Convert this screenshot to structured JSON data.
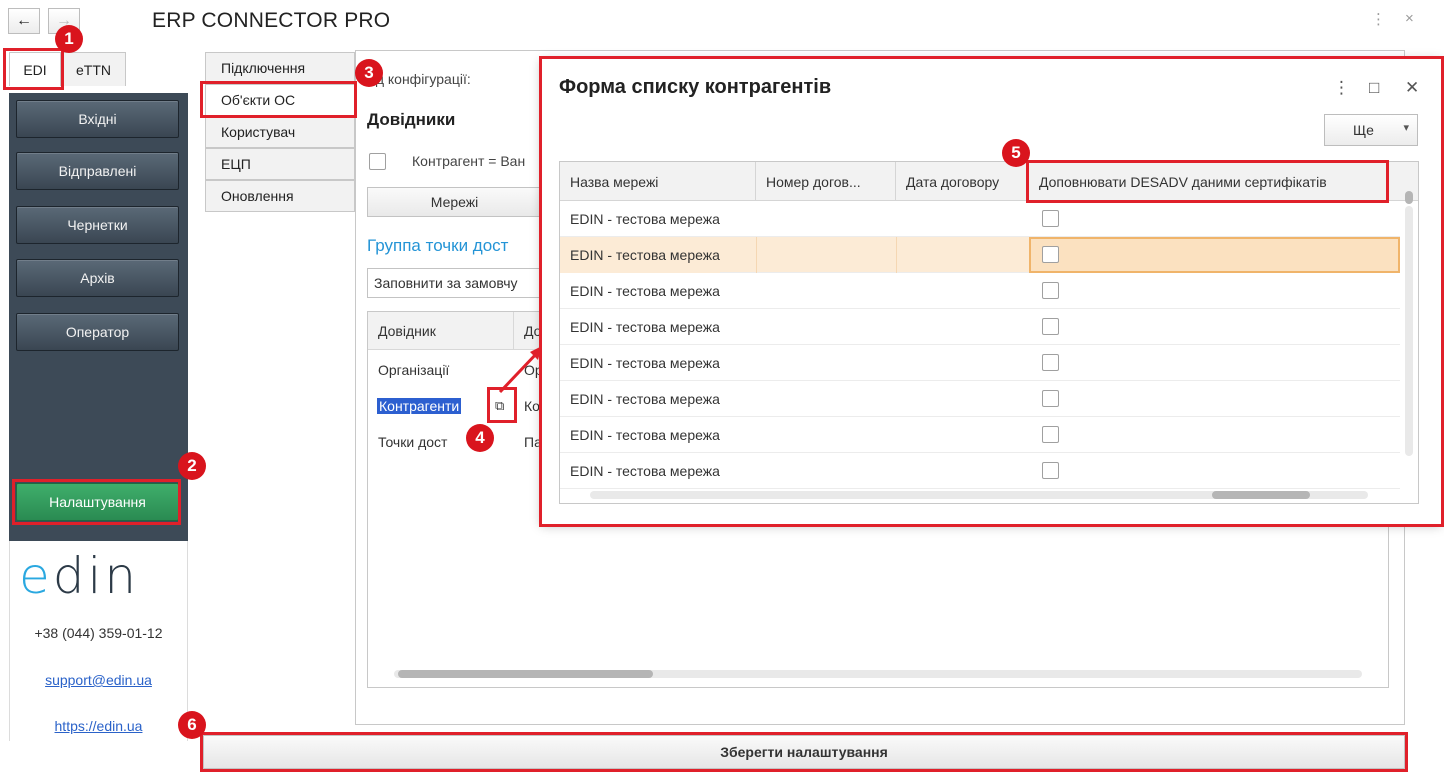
{
  "app": {
    "title": "ERP CONNECTOR PRO",
    "back_icon": "←",
    "forward_icon": "→",
    "menu_icon": "⋮",
    "close_icon": "×"
  },
  "top_tabs": [
    {
      "label": "EDI",
      "active": true
    },
    {
      "label": "eTTN",
      "active": false
    }
  ],
  "left_menu": {
    "items": [
      "Вхідні",
      "Відправлені",
      "Чернетки",
      "Архів",
      "Оператор"
    ],
    "settings": "Налаштування",
    "logo_e": "e",
    "logo_rest": "din",
    "phone": "+38 (044) 359-01-12",
    "email": "support@edin.ua",
    "site": "https://edin.ua"
  },
  "vertical_tabs": [
    "Підключення",
    "Об'єкти ОС",
    "Користувач",
    "ЕЦП",
    "Оновлення"
  ],
  "main": {
    "config_label": "ид конфігурації:",
    "section_title": "Довідники",
    "checkbox_label": "Контрагент = Ван",
    "networks_button": "Мережі",
    "group_title": "Группа точки дост",
    "fill_select": "Заповнити за замовчу",
    "table": {
      "headers": [
        "Довідник",
        "До"
      ],
      "rows": [
        {
          "name": "Організації",
          "value": "Ор"
        },
        {
          "name": "Контрагенти",
          "value": "Ко"
        },
        {
          "name": "Точки дост",
          "value": "Па"
        }
      ]
    },
    "open_icon": "⧉"
  },
  "save_button": "Зберегти налаштування",
  "popup": {
    "title": "Форма списку контрагентів",
    "menu_icon": "⋮",
    "maximize_icon": "□",
    "close_icon": "✕",
    "more_button": "Ще",
    "more_caret": "▾",
    "columns": [
      "Назва мережі",
      "Номер догов...",
      "Дата договору",
      "Доповнювати DESADV даними сертифікатів"
    ],
    "rows": [
      {
        "name": "EDIN - тестова мережа",
        "checked": false
      },
      {
        "name": "EDIN - тестова мережа",
        "checked": false,
        "selected": true
      },
      {
        "name": "EDIN - тестова мережа",
        "checked": false
      },
      {
        "name": "EDIN - тестова мережа",
        "checked": false
      },
      {
        "name": "EDIN - тестова мережа",
        "checked": false
      },
      {
        "name": "EDIN - тестова мережа",
        "checked": false
      },
      {
        "name": "EDIN - тестова мережа",
        "checked": false
      },
      {
        "name": "EDIN - тестова мережа",
        "checked": false
      }
    ]
  },
  "annotations": [
    "1",
    "2",
    "3",
    "4",
    "5",
    "6"
  ],
  "colors": {
    "annotation_red": "#e0202a",
    "sidebar_dark": "#3d4a57",
    "settings_green": "#2a8b52",
    "link_blue": "#2494d6",
    "selection_orange": "#fbe1c0"
  }
}
